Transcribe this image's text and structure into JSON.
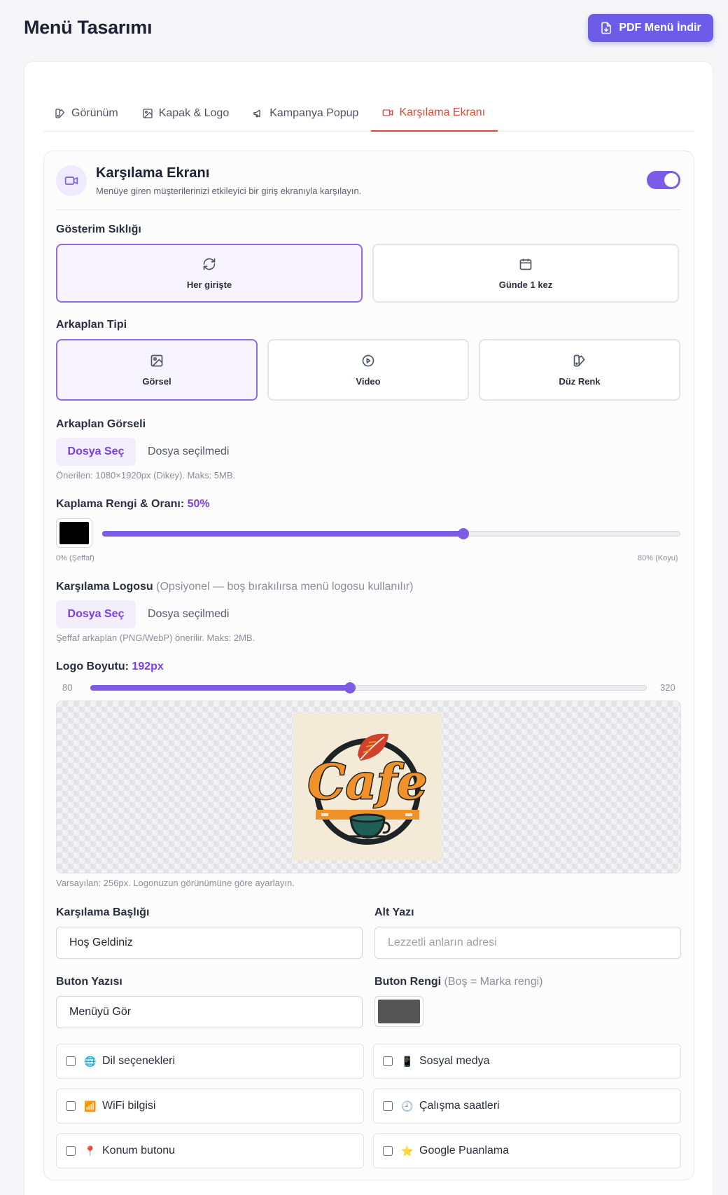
{
  "page": {
    "title": "Menü Tasarımı",
    "pdf_button": "PDF Menü İndir"
  },
  "tabs": [
    {
      "label": "Görünüm",
      "icon": "palette-icon"
    },
    {
      "label": "Kapak & Logo",
      "icon": "image-icon"
    },
    {
      "label": "Kampanya Popup",
      "icon": "megaphone-icon"
    },
    {
      "label": "Karşılama Ekranı",
      "icon": "video-icon",
      "active": true
    }
  ],
  "section": {
    "title": "Karşılama Ekranı",
    "description": "Menüye giren müşterilerinizi etkileyici bir giriş ekranıyla karşılayın.",
    "enabled": true
  },
  "frequency": {
    "label": "Gösterim Sıklığı",
    "options": [
      {
        "label": "Her girişte",
        "icon": "refresh-icon",
        "selected": true
      },
      {
        "label": "Günde 1 kez",
        "icon": "calendar-icon",
        "selected": false
      }
    ]
  },
  "background_type": {
    "label": "Arkaplan Tipi",
    "options": [
      {
        "label": "Görsel",
        "icon": "image-icon",
        "selected": true
      },
      {
        "label": "Video",
        "icon": "play-circle-icon",
        "selected": false
      },
      {
        "label": "Düz Renk",
        "icon": "palette-icon",
        "selected": false
      }
    ]
  },
  "background_image": {
    "label": "Arkaplan Görseli",
    "button": "Dosya Seç",
    "status": "Dosya seçilmedi",
    "hint": "Önerilen: 1080×1920px (Dikey). Maks: 5MB."
  },
  "overlay": {
    "label": "Kaplama Rengi & Oranı:",
    "value_text": "50%",
    "value": 50,
    "max": 80,
    "color": "#000000",
    "min_label": "0% (Şeffaf)",
    "max_label": "80% (Koyu)"
  },
  "welcome_logo": {
    "label": "Karşılama Logosu",
    "note": "(Opsiyonel — boş bırakılırsa menü logosu kullanılır)",
    "button": "Dosya Seç",
    "status": "Dosya seçilmedi",
    "hint": "Şeffaf arkaplan (PNG/WebP) önerilir. Maks: 2MB."
  },
  "logo_size": {
    "label": "Logo Boyutu:",
    "value_text": "192px",
    "value": 192,
    "min": 80,
    "max": 320,
    "min_label": "80",
    "max_label": "320",
    "hint": "Varsayılan: 256px. Logonuzun görünümüne göre ayarlayın."
  },
  "logo_preview": {
    "text": "Cafe",
    "colors": {
      "orange": "#f0912a",
      "red": "#d2412c",
      "dark": "#1e2426",
      "teal": "#1d5f57",
      "bg": "#f3ead8"
    }
  },
  "welcome_title": {
    "label": "Karşılama Başlığı",
    "value": "Hoş Geldiniz"
  },
  "subtitle": {
    "label": "Alt Yazı",
    "placeholder": "Lezzetli anların adresi"
  },
  "button_text": {
    "label": "Buton Yazısı",
    "value": "Menüyü Gör"
  },
  "button_color": {
    "label": "Buton Rengi",
    "note": "(Boş = Marka rengi)",
    "color": "#555555"
  },
  "checkboxes": [
    {
      "label": "Dil seçenekleri",
      "emoji": "🌐",
      "checked": false
    },
    {
      "label": "Sosyal medya",
      "emoji": "📱",
      "checked": false
    },
    {
      "label": "WiFi bilgisi",
      "emoji": "📶",
      "checked": false
    },
    {
      "label": "Çalışma saatleri",
      "emoji": "🕘",
      "checked": false
    },
    {
      "label": "Konum butonu",
      "emoji": "📍",
      "checked": false
    },
    {
      "label": "Google Puanlama",
      "emoji": "⭐",
      "checked": false
    }
  ],
  "colors": {
    "accent": "#7c5ce6",
    "active_tab": "#e1483b",
    "primary_button": "#6d5ce7"
  }
}
